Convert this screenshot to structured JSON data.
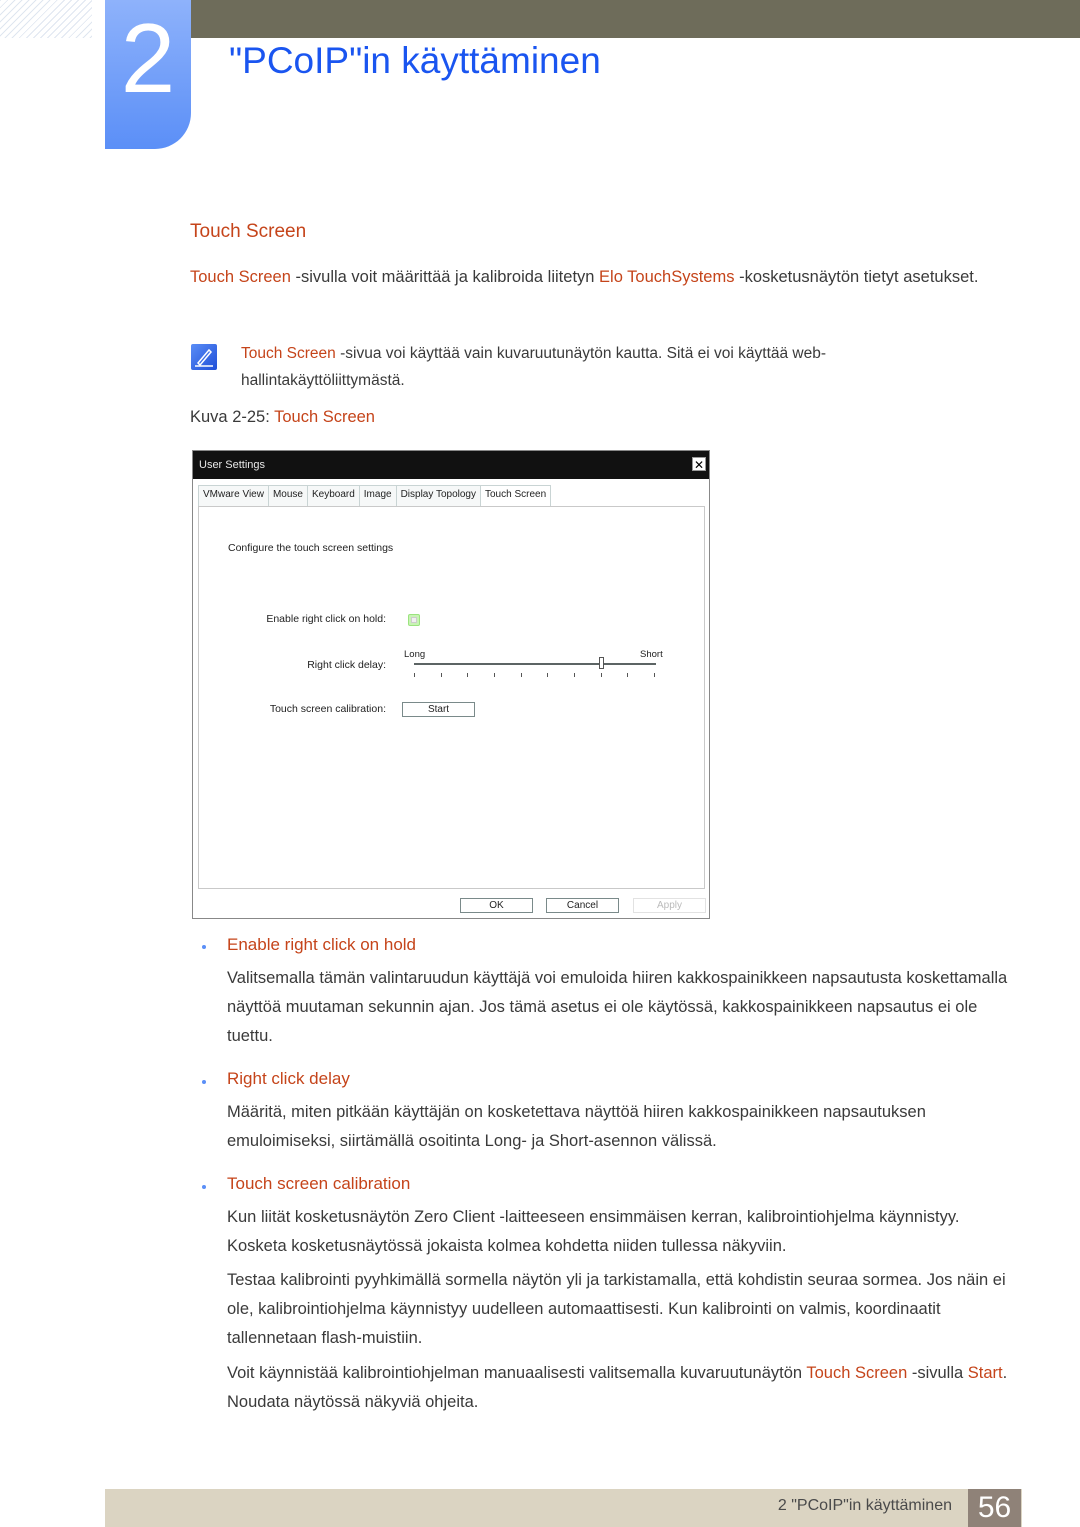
{
  "header": {
    "chapter_number": "2",
    "chapter_title": "\"PCoIP\"in käyttäminen"
  },
  "section": {
    "title": "Touch Screen",
    "intro": {
      "link1": "Touch Screen",
      "text1": " -sivulla voit määrittää ja kalibroida liitetyn ",
      "link2": "Elo TouchSystems",
      "text2": " -kosketusnäytön tietyt asetukset."
    },
    "note": {
      "icon": "note-pencil-icon",
      "link": "Touch Screen",
      "text": " -sivua voi käyttää vain kuvaruutunäytön kautta. Sitä ei voi käyttää web-hallintakäyttöliittymästä."
    },
    "caption": {
      "prefix": "Kuva 2-25: ",
      "title": "Touch Screen"
    }
  },
  "dialog": {
    "title": "User Settings",
    "close_icon": "close-icon",
    "tabs": [
      {
        "label": "VMware View",
        "active": false
      },
      {
        "label": "Mouse",
        "active": false
      },
      {
        "label": "Keyboard",
        "active": false
      },
      {
        "label": "Image",
        "active": false
      },
      {
        "label": "Display Topology",
        "active": false
      },
      {
        "label": "Touch Screen",
        "active": true
      }
    ],
    "heading": "Configure the touch screen settings",
    "enable_right_click_label": "Enable right click on hold:",
    "enable_right_click_checked": false,
    "right_click_delay_label": "Right click delay:",
    "slider": {
      "min_label": "Long",
      "max_label": "Short",
      "tick_count": 10,
      "value_fraction": 0.778
    },
    "calibration_label": "Touch screen calibration:",
    "start_button": "Start",
    "ok_button": "OK",
    "cancel_button": "Cancel",
    "apply_button": "Apply"
  },
  "bullets": [
    {
      "title": "Enable right click on hold",
      "paragraphs": [
        "Valitsemalla tämän valintaruudun käyttäjä voi emuloida hiiren kakkospainikkeen napsautusta koskettamalla näyttöä muutaman sekunnin ajan. Jos tämä asetus ei ole käytössä, kakkospainikkeen napsautus ei ole tuettu."
      ]
    },
    {
      "title": "Right click delay",
      "paragraphs": [
        "Määritä, miten pitkään käyttäjän on kosketettava näyttöä hiiren kakkospainikkeen napsautuksen emuloimiseksi, siirtämällä osoitinta Long- ja Short-asennon välissä."
      ]
    },
    {
      "title": "Touch screen calibration",
      "paragraphs": [
        "Kun liität kosketusnäytön Zero Client -laitteeseen ensimmäisen kerran, kalibrointiohjelma käynnistyy. Kosketa kosketusnäytössä jokaista kolmea kohdetta niiden tullessa näkyviin.",
        "Testaa kalibrointi pyyhkimällä sormella näytön yli ja tarkistamalla, että kohdistin seuraa sormea. Jos näin ei ole, kalibrointiohjelma käynnistyy uudelleen automaattisesti. Kun kalibrointi on valmis, koordinaatit tallennetaan flash-muistiin."
      ],
      "last": {
        "text1": "Voit käynnistää kalibrointiohjelman manuaalisesti valitsemalla kuvaruutunäytön ",
        "link1": "Touch Screen",
        "text2": " -sivulla ",
        "link2": "Start",
        "text3": ". Noudata näytössä näkyviä ohjeita."
      }
    }
  ],
  "footer": {
    "text": "2 \"PCoIP\"in käyttäminen",
    "page_number": "56"
  },
  "colors": {
    "accent": "#c5441a",
    "chapter_blue": "#1a55f0",
    "topbar": "#6e6c5a"
  }
}
